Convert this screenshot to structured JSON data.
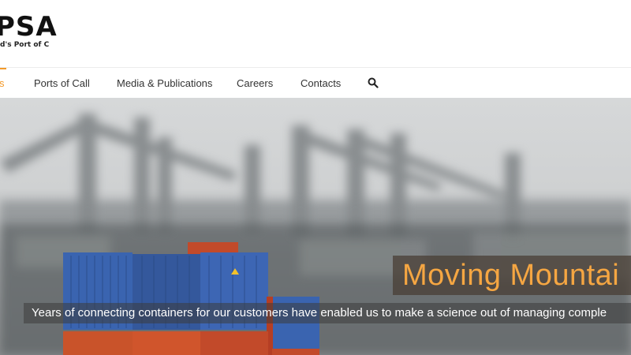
{
  "brand": {
    "name": "PSA",
    "tagline": "d's Port of Call"
  },
  "nav": {
    "items": [
      {
        "label": "s"
      },
      {
        "label": "Ports of Call"
      },
      {
        "label": "Media & Publications"
      },
      {
        "label": "Careers"
      },
      {
        "label": "Contacts"
      }
    ],
    "search_icon": "search-icon"
  },
  "hero": {
    "title": "Moving Mountai",
    "subtitle": "Years of connecting containers for our customers have enabled us to make a science out of managing comple"
  },
  "colors": {
    "accent": "#f39a2a",
    "title_text": "#f5a642",
    "container_blue": "#3a64b0",
    "container_orange": "#c9532a"
  }
}
